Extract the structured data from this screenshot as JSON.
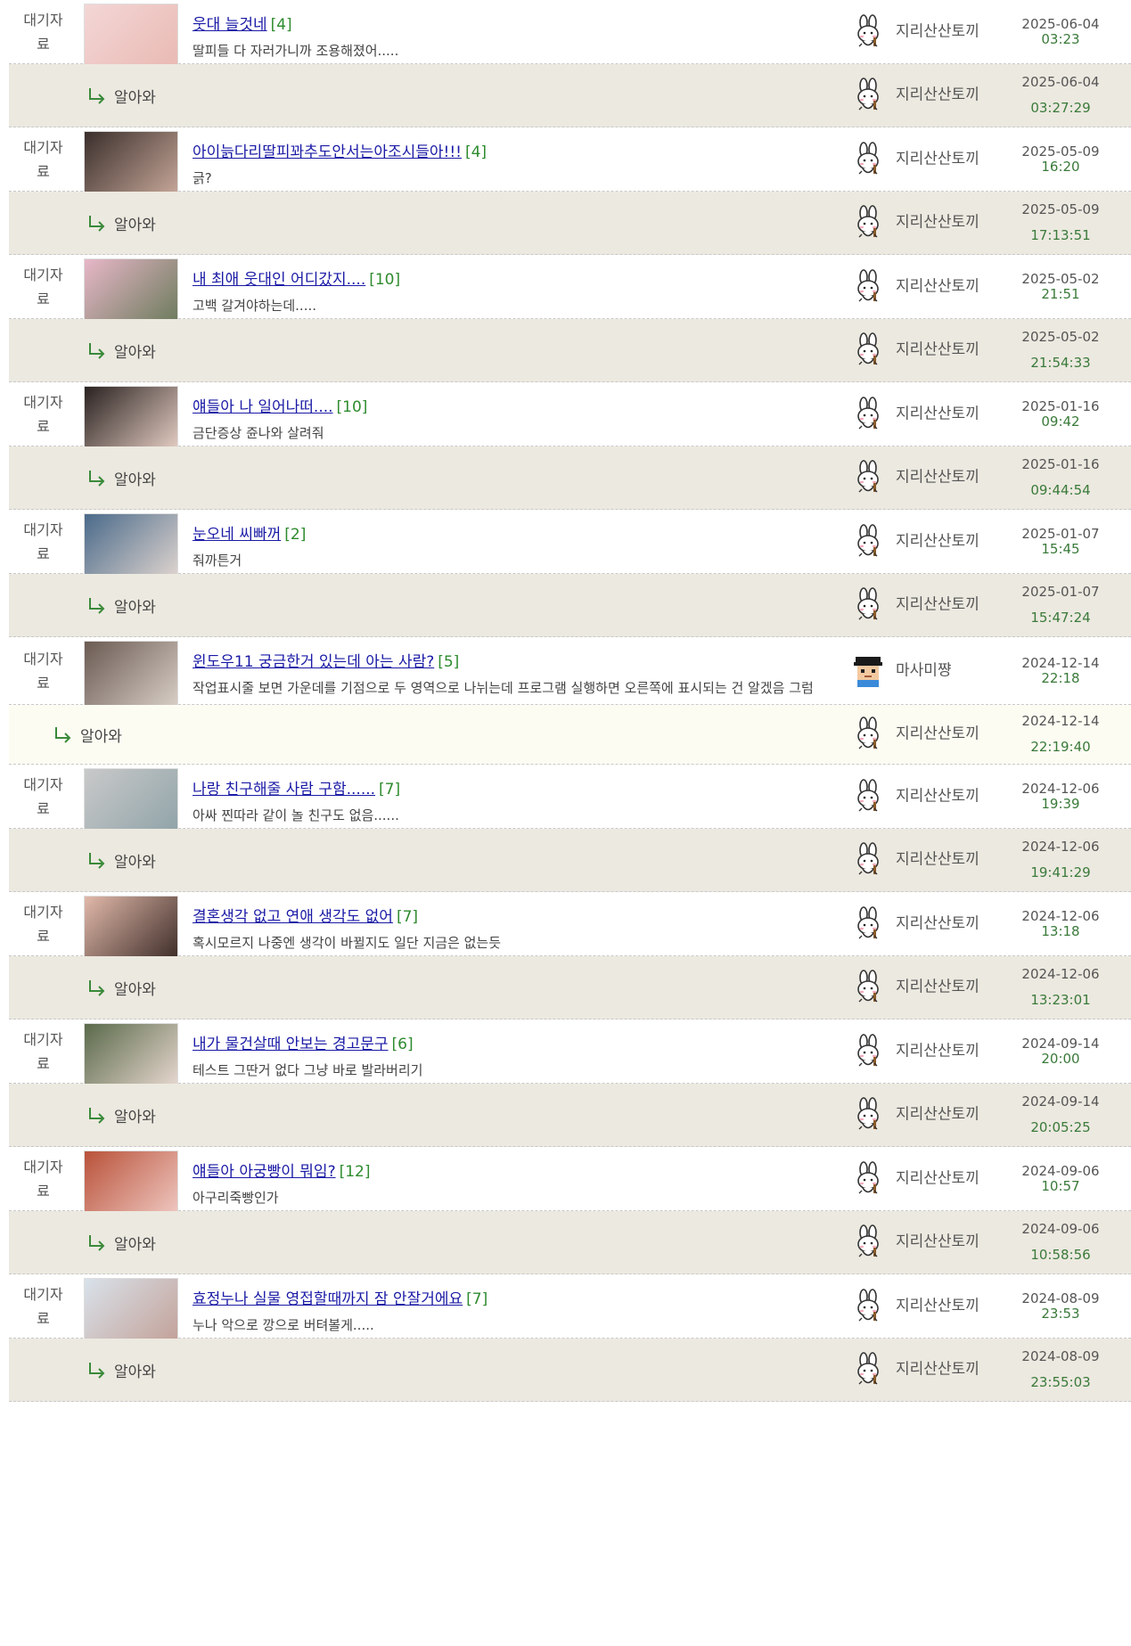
{
  "category_label": "대기자료",
  "reply_label": "알아와",
  "posts": [
    {
      "title": "웃대 늘것네",
      "count": "[4]",
      "preview": "딸피들 다 자러가니까 조용해졌어.....",
      "author": "지리산산토끼",
      "date": "2025-06-04",
      "time": "03:23",
      "reply": {
        "text": "알아와",
        "author": "지리산산토끼",
        "date": "2025-06-04",
        "time": "03:27:29"
      }
    },
    {
      "title": "아이늙다리딸피꽈추도안서는아조시들아!!!",
      "count": "[4]",
      "preview": "긁?",
      "author": "지리산산토끼",
      "date": "2025-05-09",
      "time": "16:20",
      "reply": {
        "text": "알아와",
        "author": "지리산산토끼",
        "date": "2025-05-09",
        "time": "17:13:51"
      }
    },
    {
      "title": "내 최애 웃대인 어디갔지....",
      "count": "[10]",
      "preview": "고백 갈겨야하는데.....",
      "author": "지리산산토끼",
      "date": "2025-05-02",
      "time": "21:51",
      "reply": {
        "text": "알아와",
        "author": "지리산산토끼",
        "date": "2025-05-02",
        "time": "21:54:33"
      }
    },
    {
      "title": "얘들아 나 일어나떠....",
      "count": "[10]",
      "preview": "금단증상 쥰나와 살려줘",
      "author": "지리산산토끼",
      "date": "2025-01-16",
      "time": "09:42",
      "reply": {
        "text": "알아와",
        "author": "지리산산토끼",
        "date": "2025-01-16",
        "time": "09:44:54"
      }
    },
    {
      "title": "눈오네 씨빠꺼",
      "count": "[2]",
      "preview": "줘까튼거",
      "author": "지리산산토끼",
      "date": "2025-01-07",
      "time": "15:45",
      "reply": {
        "text": "알아와",
        "author": "지리산산토끼",
        "date": "2025-01-07",
        "time": "15:47:24"
      }
    },
    {
      "title": "윈도우11 궁금한거 있는데 아는 사람?",
      "count": "[5]",
      "preview": "작업표시줄 보면 가운데를 기점으로 두 영역으로 나뉘는데 프로그램 실행하면 오른쪽에 표시되는 건 알겠음 그럼 왼쪽 빈공간은 뭘 위해 있는 공간인거임? 그냥 빈공간으로 남는거임? 뭐 표..",
      "author": "마사미쨩",
      "date": "2024-12-14",
      "time": "22:18",
      "reply": {
        "text": "알아와",
        "author": "지리산산토끼",
        "date": "2024-12-14",
        "time": "22:19:40"
      }
    },
    {
      "title": "나랑 친구해줄 사람 구함......",
      "count": "[7]",
      "preview": "아싸 찐따라 같이 놀 친구도 없음......",
      "author": "지리산산토끼",
      "date": "2024-12-06",
      "time": "19:39",
      "reply": {
        "text": "알아와",
        "author": "지리산산토끼",
        "date": "2024-12-06",
        "time": "19:41:29"
      }
    },
    {
      "title": "결혼생각 없고 연애 생각도 없어",
      "count": "[7]",
      "preview": "혹시모르지 나중엔 생각이 바뀔지도 일단 지금은 없는듯",
      "author": "지리산산토끼",
      "date": "2024-12-06",
      "time": "13:18",
      "reply": {
        "text": "알아와",
        "author": "지리산산토끼",
        "date": "2024-12-06",
        "time": "13:23:01"
      }
    },
    {
      "title": "내가 물건살때 안보는 경고문구",
      "count": "[6]",
      "preview": "테스트 그딴거 없다 그냥 바로 발라버리기",
      "author": "지리산산토끼",
      "date": "2024-09-14",
      "time": "20:00",
      "reply": {
        "text": "알아와",
        "author": "지리산산토끼",
        "date": "2024-09-14",
        "time": "20:05:25"
      }
    },
    {
      "title": "얘들아 아궁빵이 뭐임?",
      "count": "[12]",
      "preview": "아구리죽빵인가",
      "author": "지리산산토끼",
      "date": "2024-09-06",
      "time": "10:57",
      "reply": {
        "text": "알아와",
        "author": "지리산산토끼",
        "date": "2024-09-06",
        "time": "10:58:56"
      }
    },
    {
      "title": "효정누나 실물 영접할때까지 잠 안잘거에요",
      "count": "[7]",
      "preview": "누나 악으로 깡으로 버텨볼게.....",
      "author": "지리산산토끼",
      "date": "2024-08-09",
      "time": "23:53",
      "reply": {
        "text": "알아와",
        "author": "지리산산토끼",
        "date": "2024-08-09",
        "time": "23:55:03"
      }
    }
  ],
  "thumb_colors": [
    [
      "#f3d6d6",
      "#e9b9b2"
    ],
    [
      "#3a2f2c",
      "#c9a99a"
    ],
    [
      "#e7b7c8",
      "#6a7a5a"
    ],
    [
      "#2a2220",
      "#e8d0c6"
    ],
    [
      "#4a6a8a",
      "#e1d6d0"
    ],
    [
      "#6a5a52",
      "#d9cfc7"
    ],
    [
      "#c9c9c9",
      "#8fa3a8"
    ],
    [
      "#e1b9aa",
      "#3a2a26"
    ],
    [
      "#5a6a4a",
      "#eadad2"
    ],
    [
      "#b9523a",
      "#f0c9c2"
    ],
    [
      "#d9e2ea",
      "#c2a097"
    ]
  ]
}
